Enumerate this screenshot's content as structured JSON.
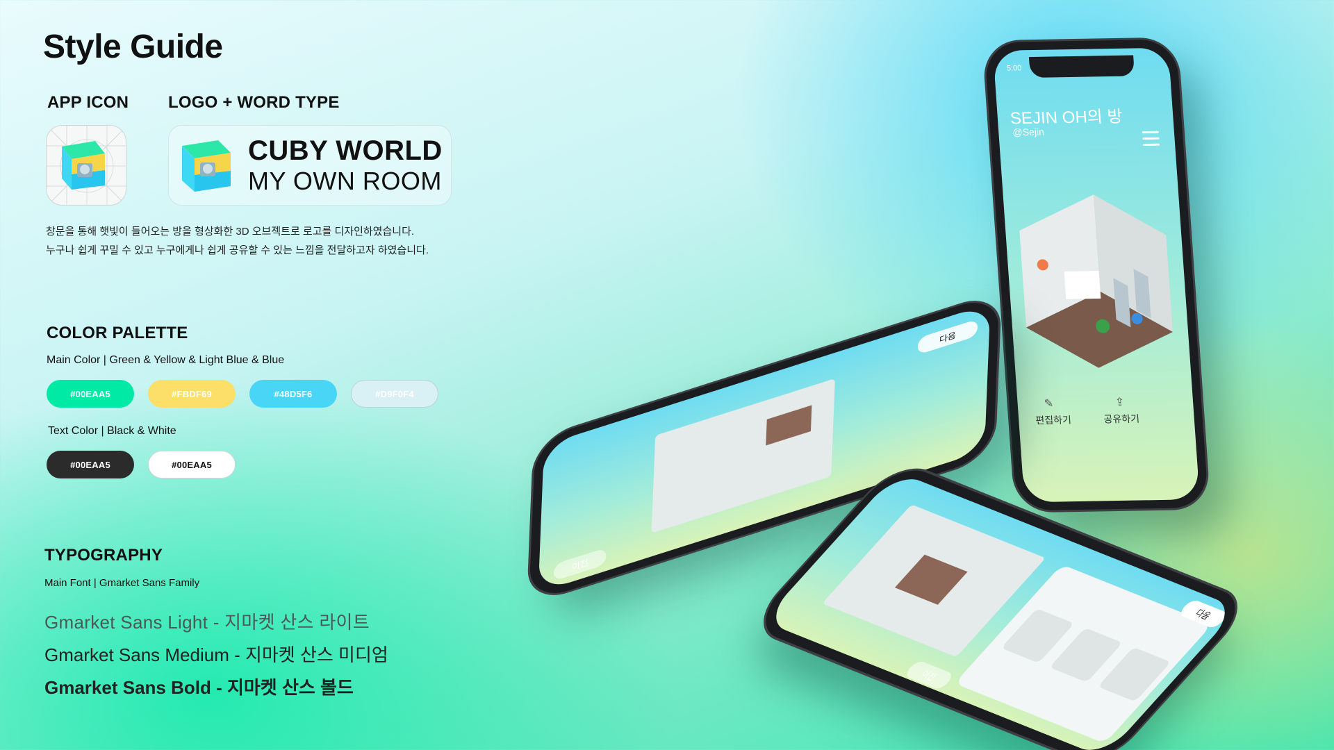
{
  "title": "Style Guide",
  "sections": {
    "app_icon": "APP ICON",
    "logo_word_type": "LOGO + WORD TYPE",
    "color_palette": "COLOR PALETTE",
    "typography": "TYPOGRAPHY"
  },
  "logo": {
    "line1": "CUBY WORLD",
    "line2": "MY OWN ROOM"
  },
  "description": [
    "창문을 통해 햇빛이 들어오는 방을 형상화한 3D 오브젝트로 로고를 디자인하였습니다.",
    "누구나 쉽게 꾸밀 수 있고 누구에게나 쉽게 공유할 수 있는 느낌을 전달하고자 하였습니다."
  ],
  "palette": {
    "main_label": "Main Color | Green & Yellow & Light Blue & Blue",
    "main_colors": [
      {
        "label": "#00EAA5",
        "color": "#00EAA5",
        "text": "#ffffff"
      },
      {
        "label": "#FBDF69",
        "color": "#FBDF69",
        "text": "#ffffff"
      },
      {
        "label": "#48D5F6",
        "color": "#48D5F6",
        "text": "#ffffff"
      },
      {
        "label": "#D9F0F4",
        "color": "#D9F0F4",
        "text": "#ffffff"
      }
    ],
    "text_label": "Text Color | Black & White",
    "text_colors": [
      {
        "label": "#00EAA5",
        "color": "#2B2B2B",
        "text": "#ffffff"
      },
      {
        "label": "#00EAA5",
        "color": "#FFFFFF",
        "text": "#111111"
      }
    ]
  },
  "typography": {
    "main_font_label": "Main Font | Gmarket Sans Family",
    "samples": [
      "Gmarket Sans Light - 지마켓 산스 라이트",
      "Gmarket Sans Medium - 지마켓 산스 미디엄",
      "Gmarket Sans Bold - 지마켓 산스 볼드"
    ]
  },
  "phone_upright": {
    "time": "5:00",
    "room_title": "SEJIN OH의 방",
    "handle": "@Sejin",
    "edit_label": "편집하기",
    "share_label": "공유하기"
  },
  "phone_middle": {
    "next_label": "다음",
    "prev_label": "이전"
  },
  "phone_bottom": {
    "next_label": "다음",
    "prev_label": "이전"
  }
}
